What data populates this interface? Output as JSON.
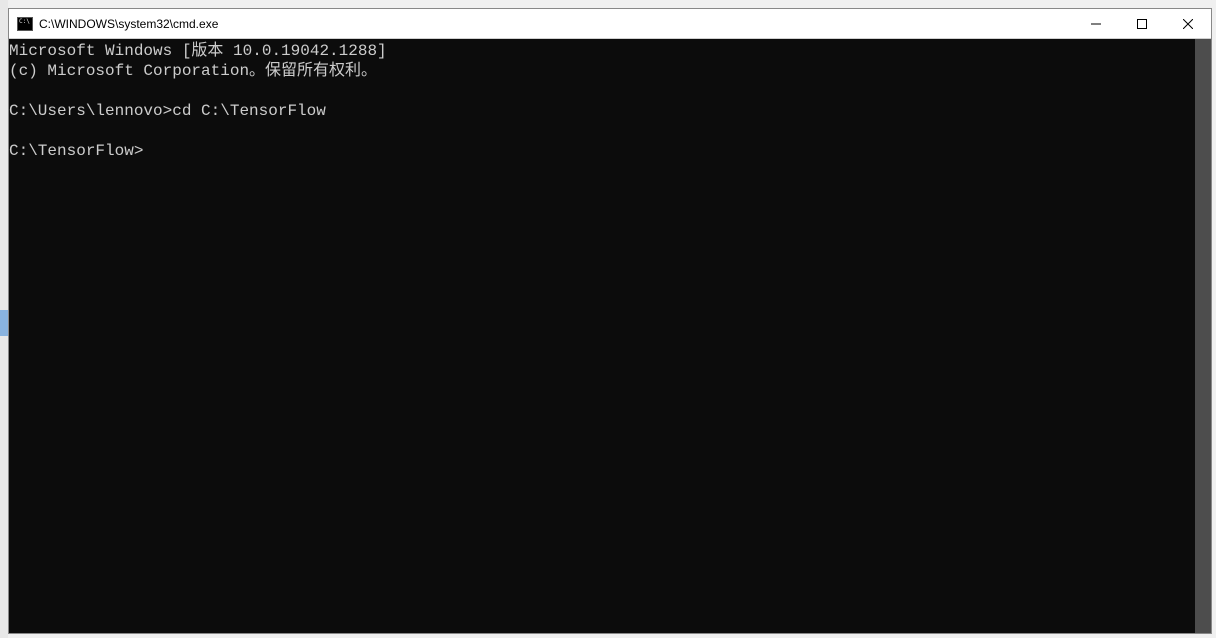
{
  "window": {
    "title": "C:\\WINDOWS\\system32\\cmd.exe"
  },
  "terminal": {
    "lines": [
      "Microsoft Windows [版本 10.0.19042.1288]",
      "(c) Microsoft Corporation。保留所有权利。",
      "",
      "C:\\Users\\lennovo>cd C:\\TensorFlow",
      "",
      "C:\\TensorFlow>"
    ]
  }
}
